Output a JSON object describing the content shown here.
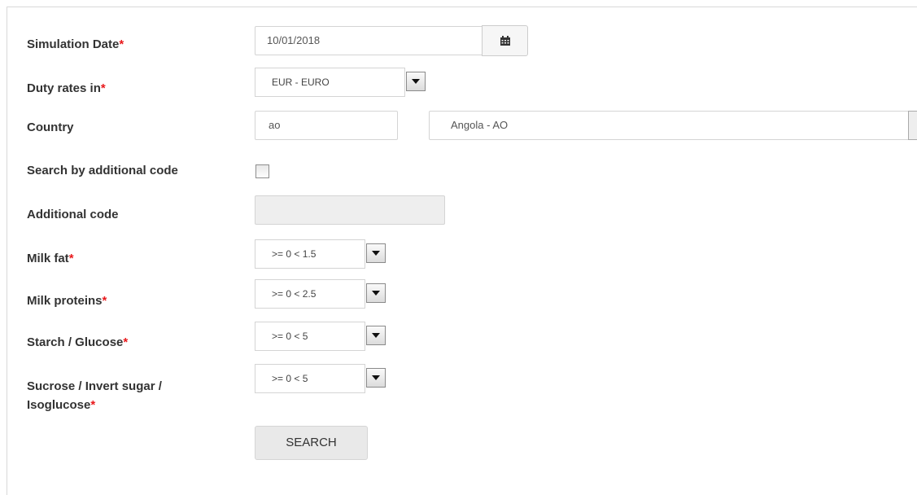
{
  "form": {
    "simulation_date": {
      "label": "Simulation Date",
      "required_mark": "*",
      "value": "10/01/2018"
    },
    "duty_rates": {
      "label": "Duty rates in",
      "required_mark": "*",
      "value": "EUR - EURO"
    },
    "country": {
      "label": "Country",
      "code_value": "ao",
      "select_value": "Angola - AO"
    },
    "search_additional": {
      "label": "Search by additional code",
      "checked": false
    },
    "additional_code": {
      "label": "Additional code",
      "value": ""
    },
    "milk_fat": {
      "label": "Milk fat",
      "required_mark": "*",
      "value": ">= 0 < 1.5"
    },
    "milk_proteins": {
      "label": "Milk proteins",
      "required_mark": "*",
      "value": ">= 0 < 2.5"
    },
    "starch_glucose": {
      "label": "Starch / Glucose",
      "required_mark": "*",
      "value": ">= 0 < 5"
    },
    "sucrose": {
      "label_line1": "Sucrose / Invert sugar /",
      "label_line2": "Isoglucose",
      "required_mark": "*",
      "value": ">= 0 < 5"
    },
    "search_button": "SEARCH"
  },
  "icons": {
    "calendar": "calendar-icon",
    "dropdown": "chevron-down-icon"
  },
  "colors": {
    "required": "#e8191c"
  }
}
